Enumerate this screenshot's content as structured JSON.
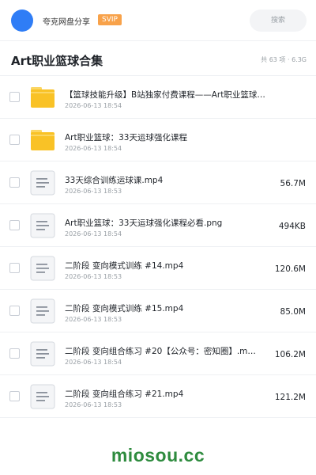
{
  "header": {
    "share_name": "夸克网盘分享",
    "badge": "SVIP",
    "search_placeholder": "搜索",
    "avatar_color": "#2f7df6"
  },
  "titlebar": {
    "title": "Art职业篮球合集",
    "summary": "共 63 项 · 6.3G"
  },
  "files": [
    {
      "type": "folder",
      "icon": "folder-icon",
      "name": "【篮球技能升级】B站独家付费课程——Art职业篮球…",
      "date": "2026-06-13 18:54",
      "size": ""
    },
    {
      "type": "folder",
      "icon": "folder-icon",
      "name": "Art职业篮球：33天运球强化课程",
      "date": "2026-06-13 18:54",
      "size": ""
    },
    {
      "type": "file",
      "icon": "file-icon",
      "name": "33天综合训练运球课.mp4",
      "date": "2026-06-13 18:53",
      "size": "56.7M"
    },
    {
      "type": "file",
      "icon": "file-icon",
      "name": "Art职业篮球：33天运球强化课程必看.png",
      "date": "2026-06-13 18:54",
      "size": "494KB"
    },
    {
      "type": "file",
      "icon": "file-icon",
      "name": "二阶段 变向模式训练 #14.mp4",
      "date": "2026-06-13 18:53",
      "size": "120.6M"
    },
    {
      "type": "file",
      "icon": "file-icon",
      "name": "二阶段 变向模式训练 #15.mp4",
      "date": "2026-06-13 18:53",
      "size": "85.0M"
    },
    {
      "type": "file",
      "icon": "file-icon",
      "name": "二阶段 变向组合练习 #20【公众号：密知圈】.m…",
      "date": "2026-06-13 18:54",
      "size": "106.2M"
    },
    {
      "type": "file",
      "icon": "file-icon",
      "name": "二阶段 变向组合练习 #21.mp4",
      "date": "2026-06-13 18:53",
      "size": "121.2M"
    }
  ],
  "watermark": "miosou.cc",
  "colors": {
    "folder": "#f9c226",
    "folder_tab": "#fbd664",
    "badge": "#f8a24a",
    "watermark": "#2e8b3e"
  }
}
